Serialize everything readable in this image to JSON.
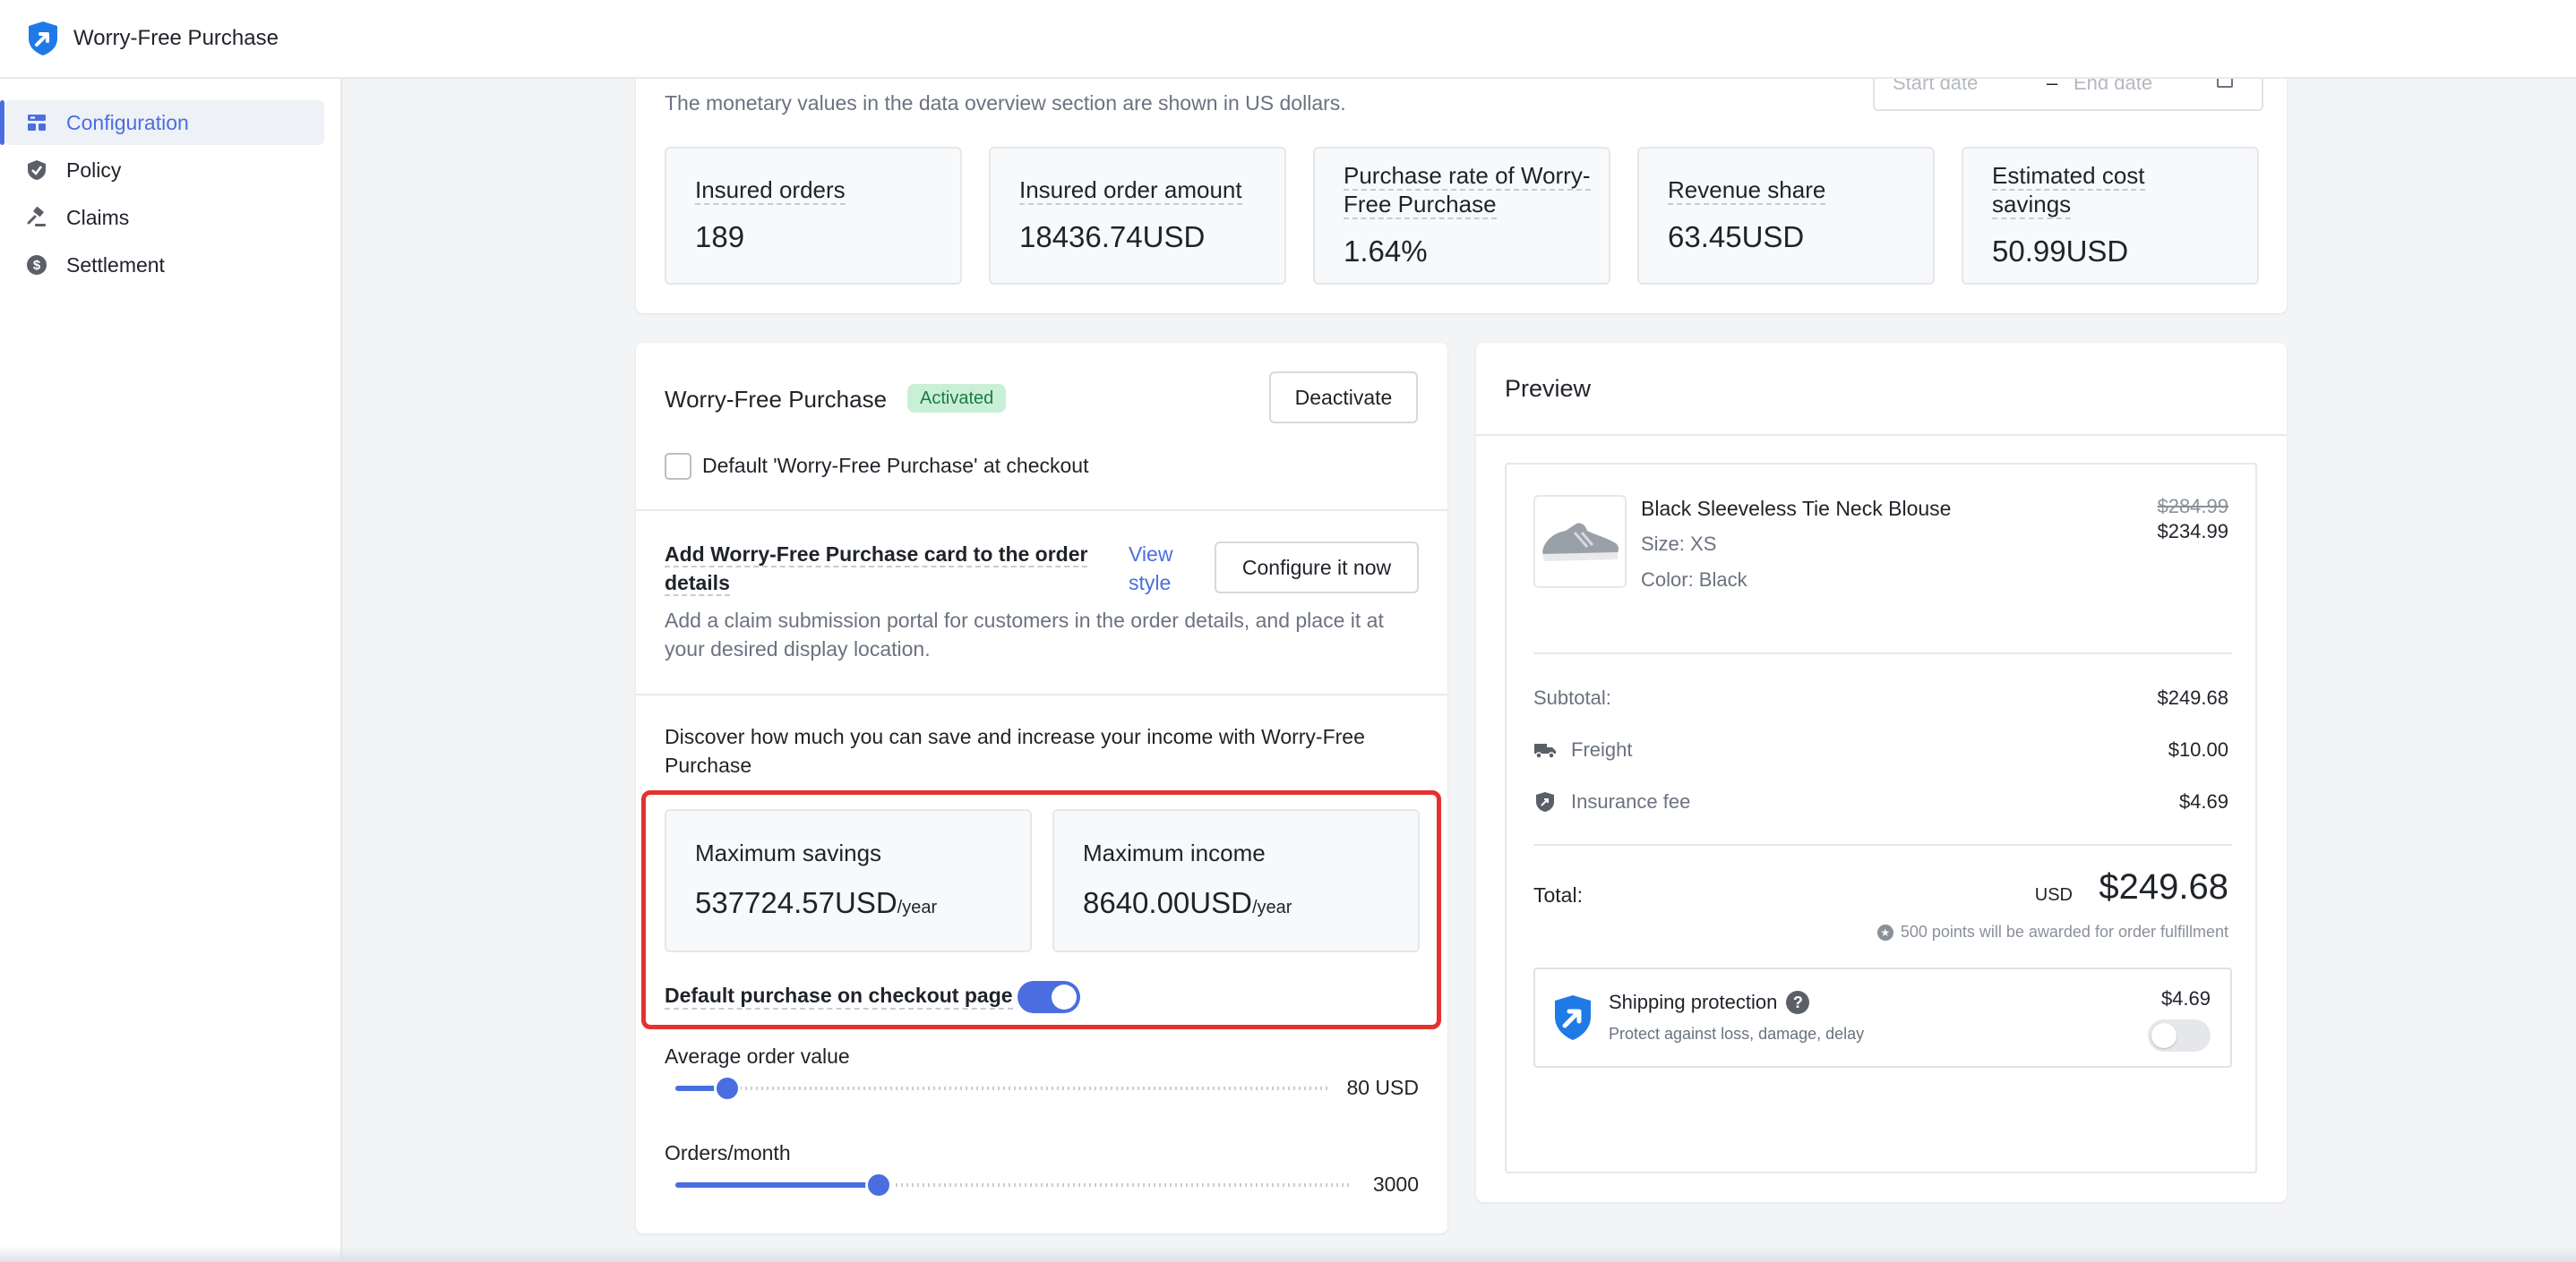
{
  "colors": {
    "accent": "#4a6ee0",
    "activated_bg": "#c9f0d6",
    "activated_text": "#1b7a45",
    "highlight_border": "#e5322d"
  },
  "header": {
    "app_title": "Worry-Free Purchase",
    "logo_icon": "shield-arrow-logo"
  },
  "sidebar": {
    "items": [
      {
        "label": "Configuration",
        "icon": "configuration-icon",
        "active": true
      },
      {
        "label": "Policy",
        "icon": "shield-icon",
        "active": false
      },
      {
        "label": "Claims",
        "icon": "gavel-icon",
        "active": false
      },
      {
        "label": "Settlement",
        "icon": "dollar-icon",
        "active": false
      }
    ]
  },
  "overview": {
    "note": "The monetary values in the data overview section are shown in US dollars.",
    "date_range": {
      "start_placeholder": "Start date",
      "separator": "–",
      "end_placeholder": "End date"
    },
    "metrics": [
      {
        "label": "Insured orders",
        "value": "189"
      },
      {
        "label": "Insured order amount",
        "value": "18436.74USD"
      },
      {
        "label": "Purchase rate of Worry-Free Purchase",
        "value": "1.64%"
      },
      {
        "label": "Revenue share",
        "value": "63.45USD"
      },
      {
        "label": "Estimated cost savings",
        "value": "50.99USD"
      }
    ]
  },
  "wfp": {
    "title": "Worry-Free Purchase",
    "status_badge": "Activated",
    "deactivate_label": "Deactivate",
    "default_checkout_checkbox": {
      "label": "Default 'Worry-Free Purchase' at checkout",
      "checked": false
    },
    "card_section": {
      "title": "Add Worry-Free Purchase card to the order details",
      "view_style": "View style",
      "configure_label": "Configure it now",
      "description": "Add a claim submission portal for customers in the order details, and place it at your desired display location."
    },
    "discover_text": "Discover how much you can save and increase your income with Worry-Free Purchase",
    "max_savings": {
      "label": "Maximum savings",
      "value": "537724.57USD",
      "unit": "/year"
    },
    "max_income": {
      "label": "Maximum income",
      "value": "8640.00USD",
      "unit": "/year"
    },
    "default_purchase": {
      "label": "Default purchase on checkout page",
      "enabled": true
    },
    "avg_order": {
      "label": "Average order value",
      "value_text": "80 USD",
      "fraction": 0.08
    },
    "orders_month": {
      "label": "Orders/month",
      "value_text": "3000",
      "fraction": 0.3
    }
  },
  "preview": {
    "title": "Preview",
    "product": {
      "name": "Black Sleeveless Tie Neck Blouse",
      "size": "Size: XS",
      "color": "Color: Black",
      "price_original": "$284.99",
      "price_sale": "$234.99"
    },
    "rows": [
      {
        "label": "Subtotal:",
        "value": "$249.68",
        "icon": ""
      },
      {
        "label": "Freight",
        "value": "$10.00",
        "icon": "truck-icon"
      },
      {
        "label": "Insurance fee",
        "value": "$4.69",
        "icon": "insurance-shield-icon"
      }
    ],
    "total": {
      "label": "Total:",
      "currency": "USD",
      "amount": "$249.68"
    },
    "points_note": "500 points will be awarded for order fulfillment",
    "shipping_protection": {
      "title": "Shipping protection",
      "subtitle": "Protect against loss, damage, delay",
      "price": "$4.69",
      "enabled": false
    }
  }
}
